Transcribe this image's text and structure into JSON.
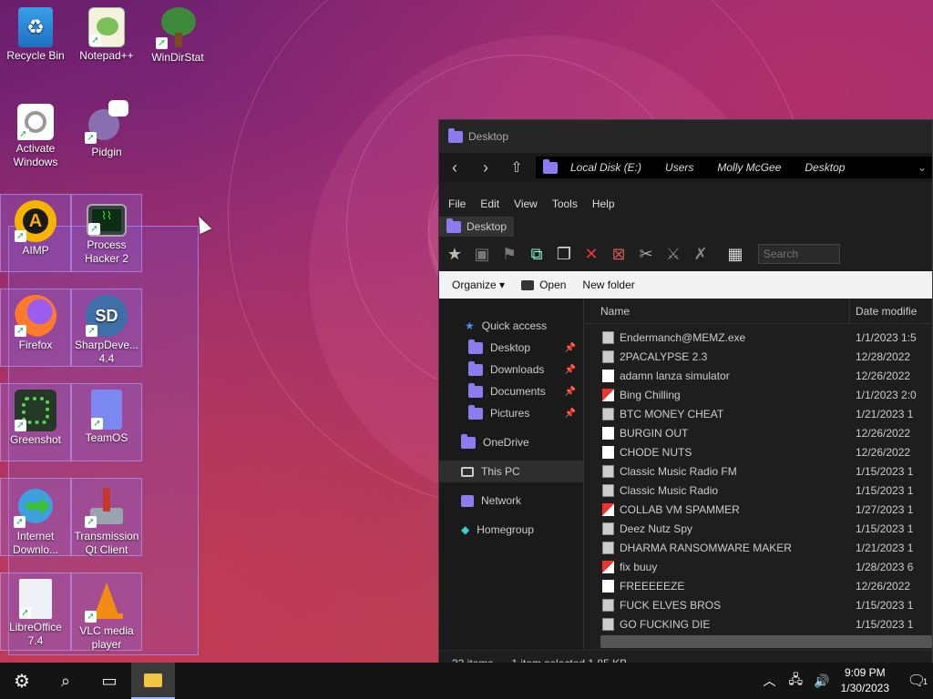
{
  "desktop": {
    "icons": [
      {
        "label": "Recycle Bin",
        "icon": "recycle-bin-icon"
      },
      {
        "label": "Notepad++",
        "icon": "notepad-plus-plus-icon"
      },
      {
        "label": "WinDirStat",
        "icon": "windirstat-icon"
      },
      {
        "label": "Activate Windows",
        "icon": "activate-windows-icon"
      },
      {
        "label": "Pidgin",
        "icon": "pidgin-icon"
      },
      {
        "label": "AIMP",
        "icon": "aimp-icon"
      },
      {
        "label": "Process Hacker 2",
        "icon": "process-hacker-icon"
      },
      {
        "label": "Firefox",
        "icon": "firefox-icon"
      },
      {
        "label": "SharpDeve... 4.4",
        "icon": "sharpdevelop-icon"
      },
      {
        "label": "Greenshot",
        "icon": "greenshot-icon"
      },
      {
        "label": "TeamOS",
        "icon": "teamos-icon"
      },
      {
        "label": "Internet Downlo...",
        "icon": "internet-download-manager-icon"
      },
      {
        "label": "Transmission Qt Client",
        "icon": "transmission-icon"
      },
      {
        "label": "LibreOffice 7.4",
        "icon": "libreoffice-icon"
      },
      {
        "label": "VLC media player",
        "icon": "vlc-icon"
      }
    ]
  },
  "explorer": {
    "title": "Desktop",
    "address": [
      "Local Disk (E:)",
      "Users",
      "Molly McGee",
      "Desktop"
    ],
    "menu": [
      "File",
      "Edit",
      "View",
      "Tools",
      "Help"
    ],
    "tab": "Desktop",
    "search_placeholder": "Search",
    "commands": {
      "organize": "Organize",
      "open": "Open",
      "new_folder": "New folder"
    },
    "nav": {
      "quick_access": "Quick access",
      "pinned": [
        "Desktop",
        "Downloads",
        "Documents",
        "Pictures"
      ],
      "onedrive": "OneDrive",
      "this_pc": "This PC",
      "network": "Network",
      "homegroup": "Homegroup"
    },
    "columns": {
      "name": "Name",
      "date": "Date modifie"
    },
    "files": [
      {
        "name": "Endermanch@MEMZ.exe",
        "date": "1/1/2023 1:5",
        "kind": "shortcut"
      },
      {
        "name": "2PACALYPSE 2.3",
        "date": "12/28/2022",
        "kind": "shortcut"
      },
      {
        "name": "adamn lanza simulator",
        "date": "12/26/2022",
        "kind": "blank"
      },
      {
        "name": "Bing Chilling",
        "date": "1/1/2023 2:0",
        "kind": "colored"
      },
      {
        "name": "BTC MONEY CHEAT",
        "date": "1/21/2023 1",
        "kind": "shortcut"
      },
      {
        "name": "BURGIN OUT",
        "date": "12/26/2022",
        "kind": "blank"
      },
      {
        "name": "CHODE NUTS",
        "date": "12/26/2022",
        "kind": "blank"
      },
      {
        "name": "Classic Music Radio FM",
        "date": "1/15/2023 1",
        "kind": "shortcut"
      },
      {
        "name": "Classic Music Radio",
        "date": "1/15/2023 1",
        "kind": "shortcut"
      },
      {
        "name": "COLLAB VM SPAMMER",
        "date": "1/27/2023 1",
        "kind": "colored"
      },
      {
        "name": "Deez Nutz Spy",
        "date": "1/15/2023 1",
        "kind": "shortcut"
      },
      {
        "name": "DHARMA RANSOMWARE MAKER",
        "date": "1/21/2023 1",
        "kind": "shortcut"
      },
      {
        "name": "fix buuy",
        "date": "1/28/2023 6",
        "kind": "colored"
      },
      {
        "name": "FREEEEEZE",
        "date": "12/26/2022",
        "kind": "blank"
      },
      {
        "name": "FUCK ELVES BROS",
        "date": "1/15/2023 1",
        "kind": "shortcut"
      },
      {
        "name": "GO FUCKING DIE",
        "date": "1/15/2023 1",
        "kind": "shortcut"
      }
    ],
    "status": {
      "count": "32 items",
      "selection": "1 item selected  1.85 KB"
    }
  },
  "taskbar": {
    "time": "9:09 PM",
    "date": "1/30/2023",
    "notification_count": "1"
  }
}
